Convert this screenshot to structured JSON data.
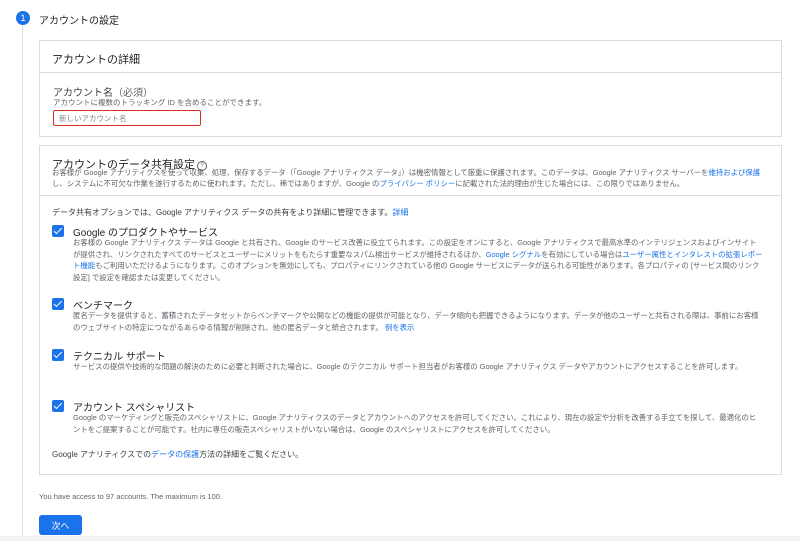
{
  "step": {
    "number": "1",
    "title": "アカウントの設定"
  },
  "details_card": {
    "title": "アカウントの詳細",
    "account_name_label": "アカウント名",
    "required_label": "（必須）",
    "helper_text": "アカウントに複数のトラッキング ID を含めることができます。",
    "input_value": "",
    "input_placeholder": "新しいアカウント名"
  },
  "sharing_card": {
    "title": "アカウントのデータ共有設定",
    "intro_1": "お客様が Google アナリティクスを使って収集、処理、保存するデータ（「Google アナリティクス データ」）は機密情報として厳重に保護されます。このデータは、Google アナリティクス サーバーを",
    "intro_link_1": "維持および保護",
    "intro_2": "し、システムに不可欠な作業を遂行するために使われます。ただし、稀ではありますが、Google の",
    "intro_link_2": "プライバシー ポリシー",
    "intro_3": "に記載された法的理由が生じた場合には、この限りではありません。",
    "options_intro": "データ共有オプションでは、Google アナリティクス データの共有をより詳細に管理できます。",
    "options_intro_link": "詳細",
    "options": [
      {
        "title": "Google のプロダクトやサービス",
        "checked": true,
        "desc_1": "お客様の Google アナリティクス データは Google と共有され、Google のサービス改善に役立てられます。この設定をオンにすると、Google アナリティクスで最高水準のインテリジェンスおよびインサイトが提供され、リンクされたすべてのサービスとユーザーにメリットをもたらす重要なスパム検出サービスが維持されるほか、",
        "desc_link_1": "Google シグナル",
        "desc_2": "を有効にしている場合は",
        "desc_link_2": "ユーザー属性とインタレストの拡張レポート機能",
        "desc_3": "もご利用いただけるようになります。このオプションを無効にしても、プロパティにリンクされている他の Google サービスにデータが送られる可能性があります。各プロパティの [サービス間のリンク設定] で設定を確認または変更してください。"
      },
      {
        "title": "ベンチマーク",
        "checked": true,
        "desc_1": "匿名データを提供すると、蓄積されたデータセットからベンチマークや公開などの機能の提供が可能となり、データ傾向も把握できるようになります。データが他のユーザーと共有される際は、事前にお客様のウェブサイトの特定につながるあらゆる情報が削除され、他の匿名データと統合されます。",
        "desc_link_1": "例を表示"
      },
      {
        "title": "テクニカル サポート",
        "checked": true,
        "desc_1": "サービスの提供や技術的な問題の解決のために必要と判断された場合に、Google のテクニカル サポート担当者がお客様の Google アナリティクス データやアカウントにアクセスすることを許可します。"
      },
      {
        "title": "アカウント スペシャリスト",
        "checked": true,
        "desc_1": "Google のマーケティングと販売のスペシャリストに、Google アナリティクスのデータとアカウントへのアクセスを許可してください。これにより、現在の設定や分析を改善する手立てを探して、最適化のヒントをご提案することが可能です。社内に専任の販売スペシャリストがいない場合は、Google のスペシャリストにアクセスを許可してください。"
      }
    ],
    "footer_1": "Google アナリティクスでの",
    "footer_link": "データの保護",
    "footer_2": "方法の詳細をご覧ください。"
  },
  "access_text": "You have access to 97 accounts. The maximum is 100.",
  "next_button": "次へ",
  "colors": {
    "accent": "#1a73e8",
    "error": "#d93025",
    "border": "#dadce0"
  }
}
